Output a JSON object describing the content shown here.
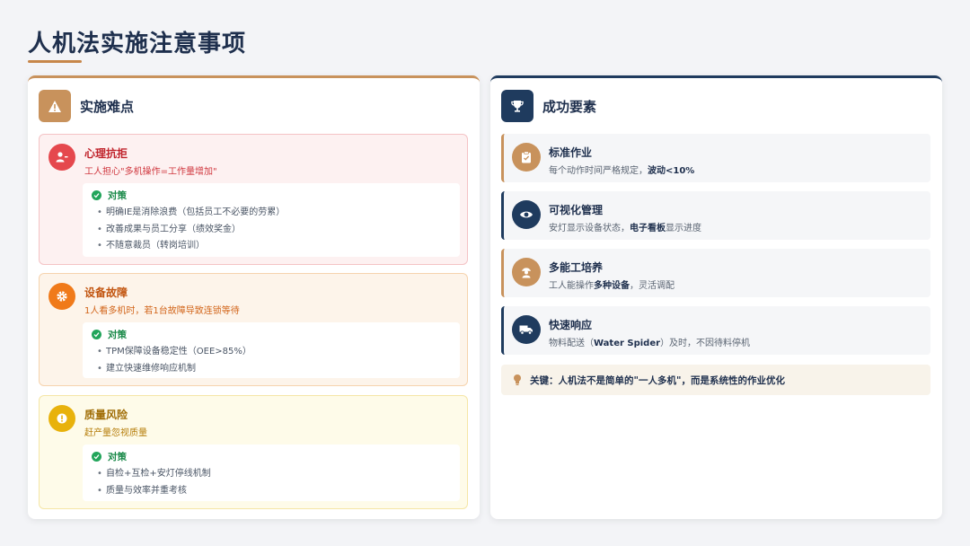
{
  "title": "人机法实施注意事项",
  "colors": {
    "accent": "#c8925c",
    "navy": "#1f3b5e"
  },
  "left_panel": {
    "title": "实施难点",
    "icon": "warning-icon",
    "cards": [
      {
        "title": "心理抗拒",
        "desc": "工人担心\"多机操作=工作量增加\"",
        "icon": "user-x-icon",
        "counter_label": "对策",
        "items": [
          "明确IE是消除浪费（包括员工不必要的劳累）",
          "改善成果与员工分享（绩效奖金）",
          "不随意裁员（转岗培训）"
        ]
      },
      {
        "title": "设备故障",
        "desc": "1人看多机时，若1台故障导致连锁等待",
        "icon": "gear-icon",
        "counter_label": "对策",
        "items": [
          "TPM保障设备稳定性（OEE>85%）",
          "建立快速维修响应机制"
        ]
      },
      {
        "title": "质量风险",
        "desc": "赶产量忽视质量",
        "icon": "alert-circle-icon",
        "counter_label": "对策",
        "items": [
          "自检+互检+安灯停线机制",
          "质量与效率并重考核"
        ]
      }
    ]
  },
  "right_panel": {
    "title": "成功要素",
    "icon": "trophy-icon",
    "items": [
      {
        "title": "标准作业",
        "desc_pre": "每个动作时间严格规定，",
        "desc_bold": "波动<10%",
        "desc_post": "",
        "icon": "clipboard-icon"
      },
      {
        "title": "可视化管理",
        "desc_pre": "安灯显示设备状态，",
        "desc_bold": "电子看板",
        "desc_post": "显示进度",
        "icon": "eye-icon"
      },
      {
        "title": "多能工培养",
        "desc_pre": "工人能操作",
        "desc_bold": "多种设备",
        "desc_post": "，灵活调配",
        "icon": "worker-icon"
      },
      {
        "title": "快速响应",
        "desc_pre": "物料配送（",
        "desc_bold": "Water Spider",
        "desc_post": "）及时，不因待料停机",
        "icon": "truck-icon"
      }
    ],
    "key_note": "关键：人机法不是简单的\"一人多机\"，而是系统性的作业优化",
    "key_icon": "lightbulb-icon"
  }
}
